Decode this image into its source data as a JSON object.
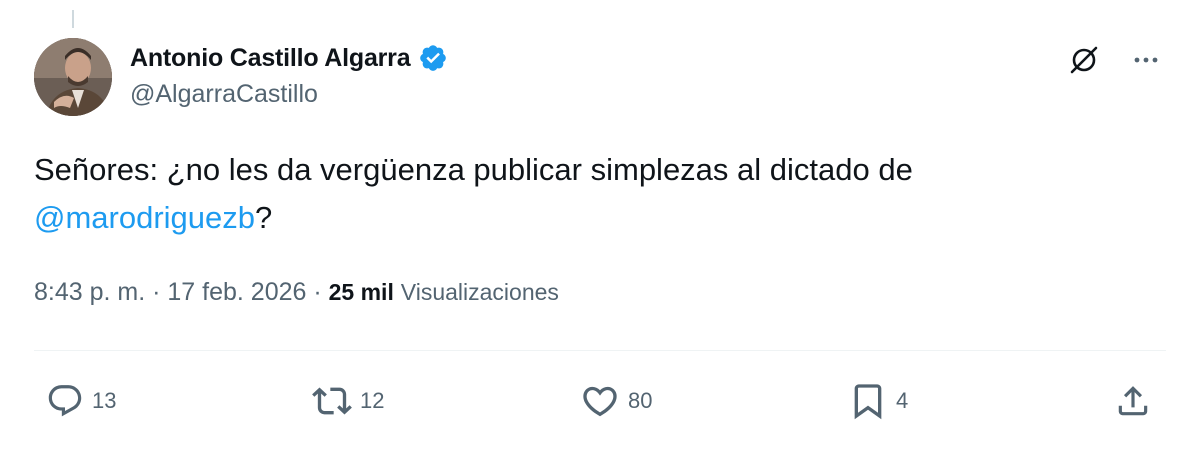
{
  "author": {
    "display_name": "Antonio Castillo Algarra",
    "handle": "@AlgarraCastillo",
    "verified": true,
    "verified_color": "#1d9bf0"
  },
  "tweet": {
    "text_before": "Señores: ¿no les da vergüenza publicar simplezas al dictado de ",
    "mention": "@marodriguezb",
    "text_after": "?",
    "time": "8:43 p. m.",
    "separator": " · ",
    "date": "17 feb. 2026",
    "views_count": "25 mil",
    "views_label": "Visualizaciones"
  },
  "actions": {
    "replies": "13",
    "reposts": "12",
    "likes": "80",
    "bookmarks": "4"
  },
  "icons": {
    "grok": "grok-icon",
    "more": "more-icon",
    "reply": "reply-icon",
    "repost": "repost-icon",
    "like": "heart-icon",
    "bookmark": "bookmark-icon",
    "share": "share-icon"
  },
  "colors": {
    "text": "#0f1419",
    "secondary": "#536471",
    "link": "#1d9bf0",
    "divider": "#eff3f4"
  }
}
